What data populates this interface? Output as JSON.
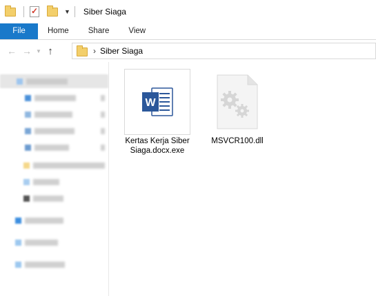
{
  "window": {
    "title": "Siber Siaga"
  },
  "ribbon": {
    "tabs": [
      "File",
      "Home",
      "Share",
      "View"
    ]
  },
  "address": {
    "path": "Siber Siaga"
  },
  "files": [
    {
      "name": "Kertas Kerja Siber Siaga.docx.exe",
      "icon": "word-document-icon"
    },
    {
      "name": "MSVCR100.dll",
      "icon": "dll-gears-icon"
    }
  ],
  "colors": {
    "file_tab": "#1979ca",
    "word_blue": "#2b579a"
  }
}
